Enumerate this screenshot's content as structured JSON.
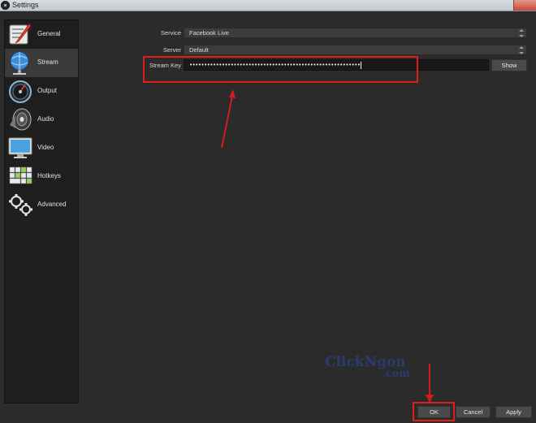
{
  "window": {
    "title": "Settings"
  },
  "sidebar": {
    "items": [
      {
        "label": "General",
        "icon": "wrench-icon"
      },
      {
        "label": "Stream",
        "icon": "globe-icon"
      },
      {
        "label": "Output",
        "icon": "gauge-icon"
      },
      {
        "label": "Audio",
        "icon": "speaker-icon"
      },
      {
        "label": "Video",
        "icon": "monitor-icon"
      },
      {
        "label": "Hotkeys",
        "icon": "keyboard-icon"
      },
      {
        "label": "Advanced",
        "icon": "gears-icon"
      }
    ],
    "active_index": 1
  },
  "stream": {
    "service_label": "Service",
    "service_value": "Facebook Live",
    "server_label": "Server",
    "server_value": "Default",
    "key_label": "Stream Key",
    "key_value": "••••••••••••••••••••••••••••••••••••••••••••••••••••••••••",
    "show_label": "Show"
  },
  "footer": {
    "ok_label": "OK",
    "cancel_label": "Cancel",
    "apply_label": "Apply"
  },
  "watermark": {
    "line1": "ClickNgon",
    "line2": ".com"
  },
  "colors": {
    "accent_red": "#e11d1d",
    "watermark_blue": "#2a3e75"
  }
}
